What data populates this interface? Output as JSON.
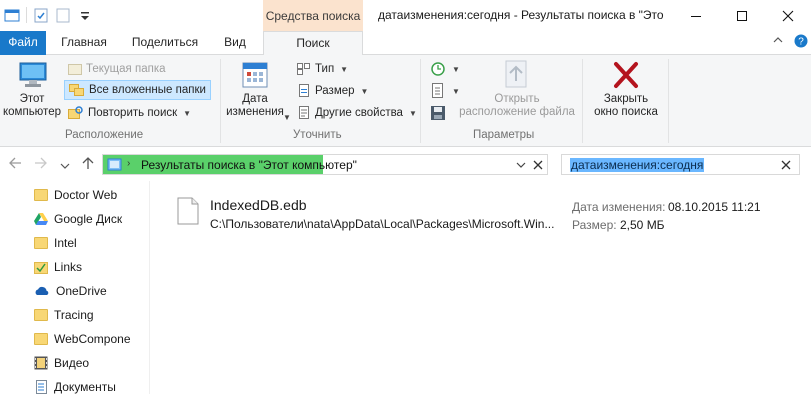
{
  "window": {
    "title": "датаизменения:сегодня - Результаты поиска в \"Это",
    "context_tab_label": "Средства поиска"
  },
  "tabs": [
    {
      "label": "Файл"
    },
    {
      "label": "Главная"
    },
    {
      "label": "Поделиться"
    },
    {
      "label": "Вид"
    },
    {
      "label": "Поиск"
    }
  ],
  "ribbon": {
    "location_group": {
      "label": "Расположение",
      "this_pc": "Этот\nкомпьютер",
      "current_folder": "Текущая папка",
      "all_subfolders": "Все вложенные папки",
      "search_again": "Повторить поиск"
    },
    "refine_group": {
      "label": "Уточнить",
      "date_modified": "Дата\nизменения",
      "type": "Тип",
      "size": "Размер",
      "other_properties": "Другие свойства"
    },
    "options_group": {
      "label": "Параметры",
      "open_location": "Открыть\nрасположение файла"
    },
    "close_search": "Закрыть\nокно поиска"
  },
  "address": {
    "path": "Результаты поиска в \"Этот компьютер\""
  },
  "search": {
    "query": "датаизменения:сегодня"
  },
  "nav_items": [
    {
      "label": "Doctor Web",
      "icon": "folder-icon"
    },
    {
      "label": "Google Диск",
      "icon": "google-drive-icon"
    },
    {
      "label": "Intel",
      "icon": "folder-icon"
    },
    {
      "label": "Links",
      "icon": "links-folder-icon"
    },
    {
      "label": "OneDrive",
      "icon": "onedrive-icon"
    },
    {
      "label": "Tracing",
      "icon": "folder-icon"
    },
    {
      "label": "WebCompone",
      "icon": "folder-icon"
    },
    {
      "label": "Видео",
      "icon": "video-folder-icon"
    },
    {
      "label": "Документы",
      "icon": "documents-folder-icon"
    }
  ],
  "result": {
    "name": "IndexedDB.edb",
    "path": "C:\\Пользователи\\nata\\AppData\\Local\\Packages\\Microsoft.Win...",
    "date_label": "Дата изменения:",
    "date_value": "08.10.2015 11:21",
    "size_label": "Размер:",
    "size_value": "2,50 МБ"
  },
  "colors": {
    "file_tab": "#1979ca",
    "context_tab": "#fbe3ce",
    "progress": "#5ad06a",
    "selection": "#6ab7ff",
    "close_x": "#b4141e"
  }
}
